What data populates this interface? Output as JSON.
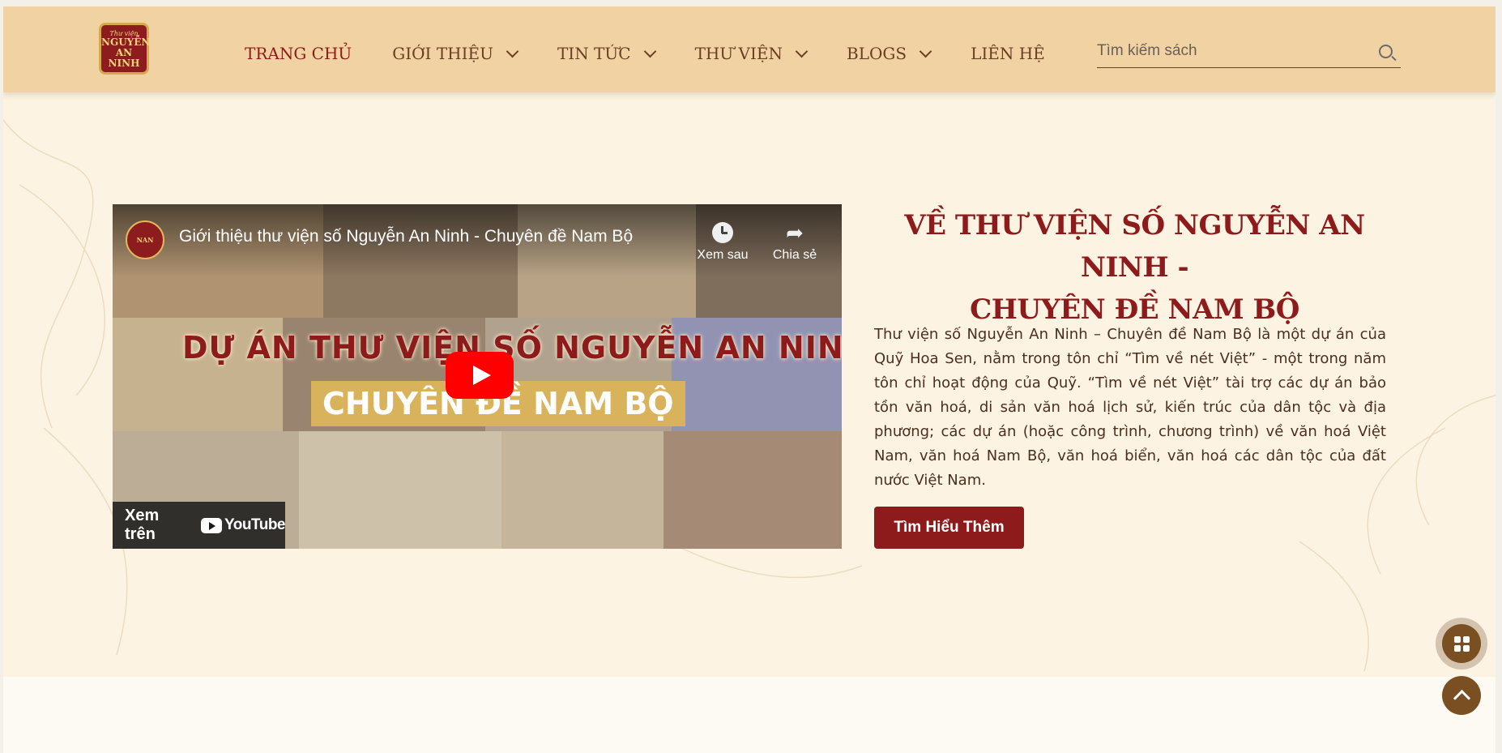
{
  "header": {
    "logo": {
      "line1": "Thư viện",
      "line2": "NGUYỄN",
      "line3": "AN NINH"
    },
    "nav": [
      {
        "label": "TRANG CHỦ",
        "active": true
      },
      {
        "label": "GIỚI THIỆU",
        "dropdown": true
      },
      {
        "label": "TIN TỨC",
        "dropdown": true
      },
      {
        "label": "THƯ VIỆN",
        "dropdown": true
      },
      {
        "label": "BLOGS",
        "dropdown": true
      },
      {
        "label": "LIÊN HỆ"
      }
    ],
    "search": {
      "placeholder": "Tìm kiếm sách",
      "value": ""
    }
  },
  "video": {
    "title": "Giới thiệu thư viện số Nguyễn An Ninh - Chuyên đề Nam Bộ",
    "watch_later": "Xem sau",
    "share": "Chia sẻ",
    "banner_line1": "DỰ ÁN THƯ VIỆN SỐ NGUYỄN AN NINH",
    "banner_line2": "CHUYÊN ĐỀ NAM BỘ",
    "watch_on": "Xem trên",
    "youtube": "YouTube"
  },
  "about": {
    "title_line1": "VỀ THƯ VIỆN SỐ NGUYỄN AN NINH -",
    "title_line2": "CHUYÊN ĐỀ NAM BỘ",
    "body": "Thư viện số Nguyễn An Ninh – Chuyên đề Nam Bộ là một dự án của Quỹ Hoa Sen, nằm trong tôn chỉ “Tìm về nét Việt” - một trong năm tôn chỉ hoạt động của Quỹ. “Tìm về nét Việt” tài trợ các dự án bảo tồn văn hoá, di sản văn hoá lịch sử, kiến trúc của dân tộc và địa phương; các dự án (hoặc công trình, chương trình) về văn hoá Việt Nam, văn hoá Nam Bộ, văn hoá biển, văn hoá các dân tộc của đất nước Việt Nam.",
    "cta": "Tìm Hiểu Thêm"
  },
  "colors": {
    "header_bg": "#f1d3a3",
    "page_bg": "#fcf3e2",
    "accent": "#8e1b1b",
    "nav_text": "#6a3e22",
    "float_button": "#7a4f22"
  },
  "icons": {
    "search": "search-icon",
    "chevron": "chevron-down-icon",
    "watch_later": "clock-icon",
    "share": "share-icon",
    "play": "play-icon",
    "grid": "grid-icon",
    "scroll_top": "chevron-up-icon"
  }
}
